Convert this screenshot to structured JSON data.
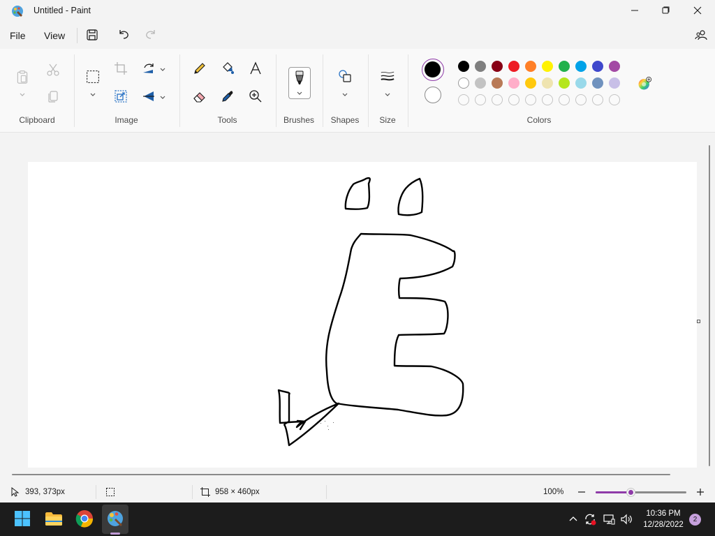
{
  "window": {
    "title": "Untitled - Paint",
    "minimize_icon": "minimize-icon",
    "maximize_icon": "maximize-icon",
    "close_icon": "close-icon"
  },
  "menu": {
    "file_label": "File",
    "view_label": "View",
    "save_icon": "save-icon",
    "undo_icon": "undo-icon",
    "redo_icon": "redo-icon",
    "account_icon": "account-icon"
  },
  "ribbon": {
    "groups": [
      {
        "label": "Clipboard"
      },
      {
        "label": "Image"
      },
      {
        "label": "Tools"
      },
      {
        "label": "Brushes"
      },
      {
        "label": "Shapes"
      },
      {
        "label": "Size"
      },
      {
        "label": "Colors"
      }
    ],
    "colors": {
      "primary": "#000000",
      "secondary": "#ffffff",
      "row1": [
        "#000000",
        "#7f7f7f",
        "#880015",
        "#ed1c24",
        "#ff7f27",
        "#fff200",
        "#22b14c",
        "#00a2e8",
        "#3f48cc",
        "#a349a4"
      ],
      "row2": [
        "#ffffff",
        "#c3c3c3",
        "#b97a57",
        "#ffaec9",
        "#ffc90e",
        "#efe4b0",
        "#b5e61d",
        "#99d9ea",
        "#7092be",
        "#c8bfe7"
      ],
      "row3_empty_count": 10
    }
  },
  "canvas": {
    "background": "#ffffff"
  },
  "status": {
    "cursor_position": "393, 373px",
    "canvas_size": "958 × 460px",
    "zoom": "100%",
    "zoom_fraction": 0.39
  },
  "taskbar": {
    "time": "10:36 PM",
    "date": "12/28/2022",
    "notification_count": "2"
  },
  "accent_color": "#8e3aa8"
}
